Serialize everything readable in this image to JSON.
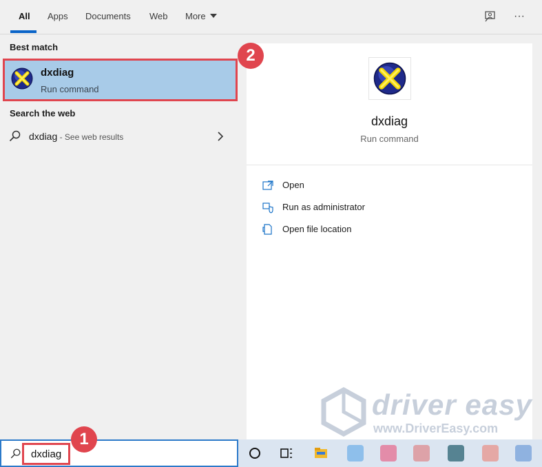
{
  "tabs": [
    {
      "label": "All"
    },
    {
      "label": "Apps"
    },
    {
      "label": "Documents"
    },
    {
      "label": "Web"
    },
    {
      "label": "More"
    }
  ],
  "top_icons": {
    "feedback": "feedback-icon",
    "more": "···"
  },
  "left": {
    "best_match_title": "Best match",
    "best_item": {
      "name": "dxdiag",
      "subtitle": "Run command",
      "icon": "directx-icon"
    },
    "web_title": "Search the web",
    "web_item": {
      "query": "dxdiag",
      "suffix": " - See web results",
      "icon": "search-icon"
    }
  },
  "details": {
    "title": "dxdiag",
    "subtitle": "Run command",
    "actions": [
      {
        "label": "Open",
        "icon": "open-icon"
      },
      {
        "label": "Run as administrator",
        "icon": "shield-icon"
      },
      {
        "label": "Open file location",
        "icon": "file-location-icon"
      }
    ]
  },
  "search": {
    "value": "dxdiag"
  },
  "badges": {
    "one": "1",
    "two": "2"
  },
  "watermark": {
    "text": "driver easy",
    "url": "www.DriverEasy.com"
  },
  "colors": {
    "accent": "#0a64c8",
    "highlight": "#a8cbe8",
    "annotation": "#e0454e"
  }
}
